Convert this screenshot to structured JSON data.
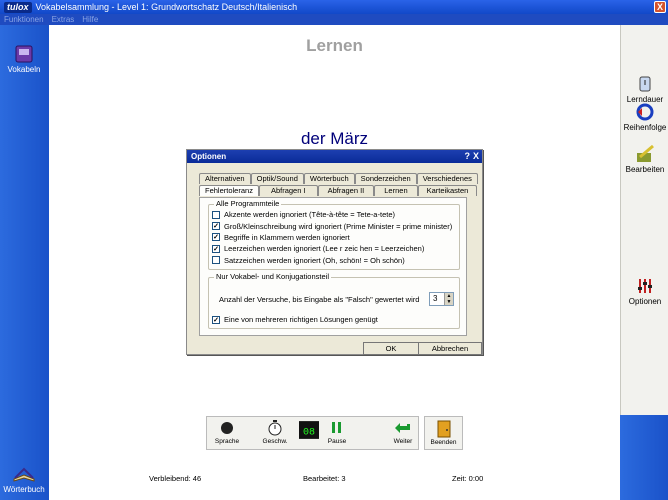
{
  "window": {
    "logo": "tulox",
    "title": "Vokabelsammlung - Level 1: Grundwortschatz Deutsch/Italienisch",
    "close": "X"
  },
  "menu": [
    "Funktionen",
    "Extras",
    "Hilfe"
  ],
  "left_sidebar": [
    {
      "label": "Vokabeln",
      "icon": "book-icon"
    },
    {
      "label": "Wörterbuch",
      "icon": "open-book-icon"
    }
  ],
  "right_sidebar": [
    {
      "label": "Lerndauer",
      "icon": "clock-icon"
    },
    {
      "label": "Reihenfolge",
      "icon": "order-icon"
    },
    {
      "label": "Bearbeiten",
      "icon": "edit-icon"
    },
    {
      "label": "Optionen",
      "icon": "options-icon"
    }
  ],
  "main": {
    "heading": "Lernen",
    "word": "der März"
  },
  "dialog": {
    "title": "Optionen",
    "help": "?",
    "close": "X",
    "tabs_row1": [
      "Alternativen",
      "Optik/Sound",
      "Wörterbuch",
      "Sonderzeichen",
      "Verschiedenes"
    ],
    "tabs_row2": [
      "Fehlertoleranz",
      "Abfragen I",
      "Abfragen II",
      "Lernen",
      "Karteikasten"
    ],
    "group1": {
      "label": "Alle Programmteile",
      "options": [
        {
          "text": "Akzente werden ignoriert (Tête-à-tête = Tete-a-tete)",
          "checked": false
        },
        {
          "text": "Groß/Kleinschreibung wird ignoriert (Prime Minister = prime minister)",
          "checked": true
        },
        {
          "text": "Begriffe in Klammern werden ignoriert",
          "checked": true
        },
        {
          "text": "Leerzeichen werden ignoriert (Lee r zeic hen = Leerzeichen)",
          "checked": true
        },
        {
          "text": "Satzzeichen werden ignoriert (Oh, schön! = Oh schön)",
          "checked": false
        }
      ]
    },
    "group2": {
      "label": "Nur Vokabel- und Konjugationsteil",
      "spin_label": "Anzahl der Versuche, bis Eingabe als \"Falsch\" gewertet wird",
      "spin_value": "3",
      "option": {
        "text": "Eine von mehreren richtigen Lösungen genügt",
        "checked": true
      }
    },
    "ok": "OK",
    "cancel": "Abbrechen"
  },
  "toolbar": [
    {
      "label": "Sprache",
      "icon": "speaker-icon"
    },
    {
      "label": "Geschw.",
      "icon": "stopwatch-icon"
    },
    {
      "label": "",
      "icon": "display-icon"
    },
    {
      "label": "Pause",
      "icon": "pause-icon"
    },
    {
      "label": "Weiter",
      "icon": "next-arrow-icon"
    }
  ],
  "beenden": "Beenden",
  "status": {
    "verbleibend": "Verbleibend: 46",
    "bearbeitet": "Bearbeitet: 3",
    "zeit": "Zeit: 0:00"
  },
  "colors": {
    "title_bar": "#1148c8",
    "side_blue": "#1a52c9",
    "word": "#00007a",
    "heading": "#a0a0a0"
  }
}
